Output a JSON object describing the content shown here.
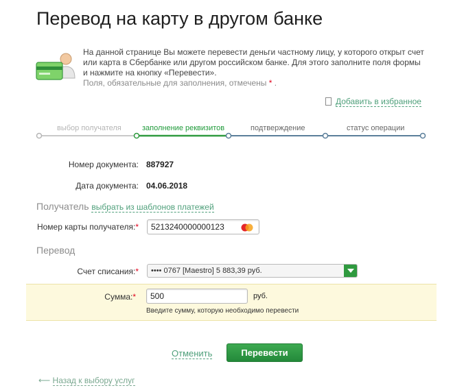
{
  "page": {
    "title": "Перевод на карту в другом банке"
  },
  "info": {
    "text": "На данной странице Вы можете перевести деньги частному лицу, у которого открыт счет или карта в Сбербанке или другом российском банке. Для этого заполните поля формы и нажмите на кнопку «Перевести».",
    "required_note": "Поля, обязательные для заполнения, отмечены",
    "required_mark": "*",
    "required_end": "."
  },
  "favorites": {
    "label": "Добавить в избранное"
  },
  "steps": [
    {
      "label": "выбор получателя",
      "state": "done"
    },
    {
      "label": "заполнение реквизитов",
      "state": "active"
    },
    {
      "label": "подтверждение",
      "state": "pending"
    },
    {
      "label": "статус операции",
      "state": "pending"
    }
  ],
  "document": {
    "number_label": "Номер документа:",
    "number_value": "887927",
    "date_label": "Дата документа:",
    "date_value": "04.06.2018"
  },
  "recipient": {
    "section_title": "Получатель",
    "templates_link": "выбрать из шаблонов платежей",
    "card_label": "Номер карты получателя:",
    "card_value": "5213240000000123",
    "required_mark": "*"
  },
  "transfer": {
    "section_title": "Перевод",
    "account_label": "Счет списания:",
    "account_value": "•••• 0767  [Maestro] 5 883,39  руб.",
    "amount_label": "Сумма:",
    "amount_value": "500",
    "currency": "руб.",
    "amount_hint": "Введите сумму, которую необходимо перевести",
    "required_mark": "*"
  },
  "actions": {
    "cancel": "Отменить",
    "submit": "Перевести",
    "back": "Назад к выбору услуг",
    "back_arrow": "⟵"
  },
  "colors": {
    "accent": "#2f9a3f",
    "link": "#4e9f7a",
    "required": "#e0001b",
    "sum_highlight": "#fdf9dd",
    "step_done": "#b5b5b5",
    "step_pending": "#5a7e9a"
  }
}
